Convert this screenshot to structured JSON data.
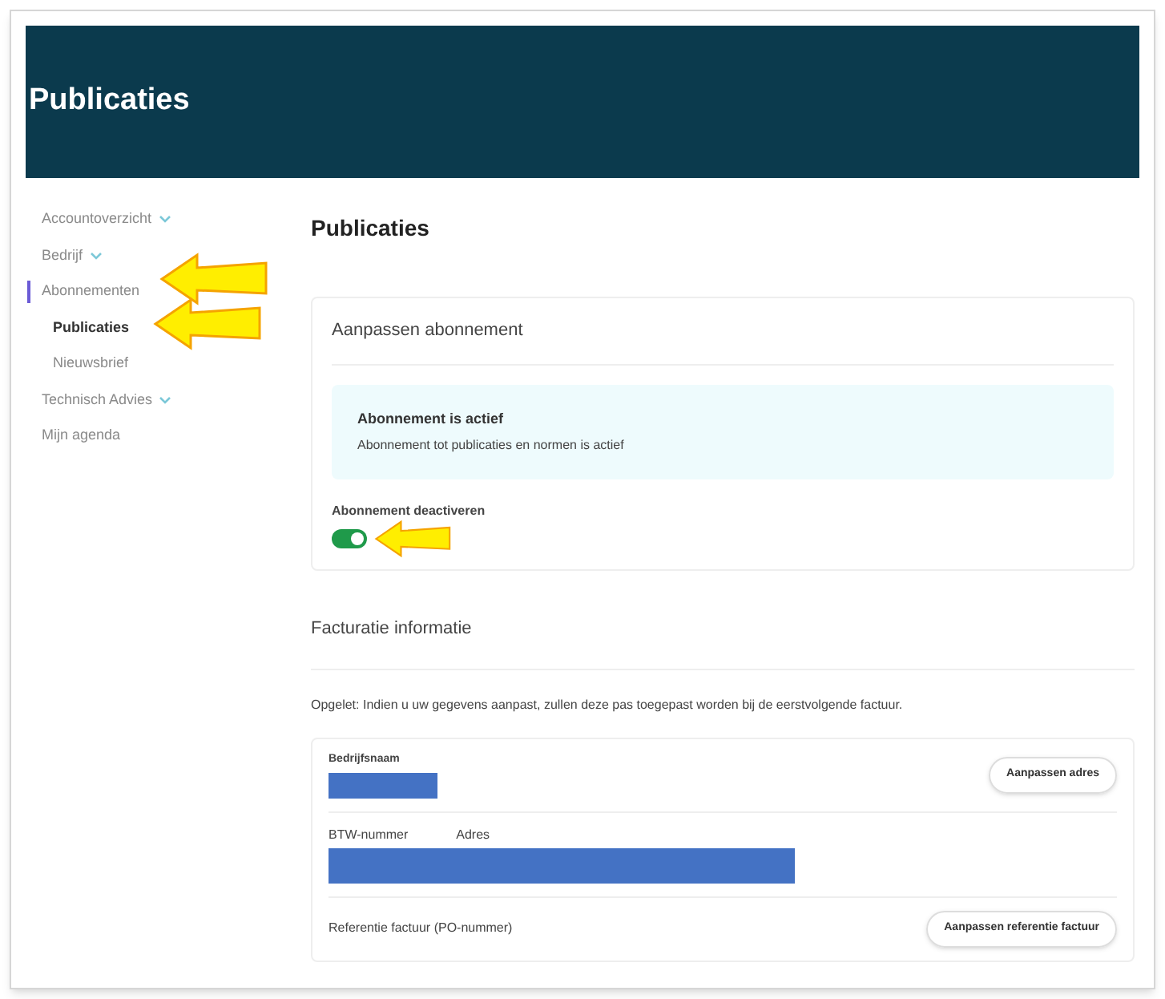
{
  "banner": {
    "title": "Publicaties"
  },
  "sidebar": {
    "items": [
      {
        "label": "Accountoverzicht",
        "expandable": true,
        "selected": false
      },
      {
        "label": "Bedrijf",
        "expandable": true,
        "selected": false
      },
      {
        "label": "Abonnementen",
        "expandable": false,
        "selected": true,
        "children": [
          {
            "label": "Publicaties",
            "selected": true
          },
          {
            "label": "Nieuwsbrief",
            "selected": false
          }
        ]
      },
      {
        "label": "Technisch Advies",
        "expandable": true,
        "selected": false
      },
      {
        "label": "Mijn agenda",
        "expandable": false,
        "selected": false
      }
    ]
  },
  "page_title": "Publicaties",
  "subscription": {
    "title": "Aanpassen abonnement",
    "alert_title": "Abonnement is actief",
    "alert_text": "Abonnement tot publicaties en normen is actief",
    "toggle_label": "Abonnement deactiveren",
    "toggle_on": true
  },
  "billing": {
    "title": "Facturatie informatie",
    "note": "Opgelet: Indien u uw gegevens aanpast, zullen deze pas toegepast worden bij de eerstvolgende factuur.",
    "company_label": "Bedrijfsnaam",
    "address_button": "Aanpassen adres",
    "vat_label": "BTW-nummer",
    "address_label": "Adres",
    "reference_label": "Referentie factuur (PO-nummer)",
    "reference_button": "Aanpassen referentie factuur"
  }
}
